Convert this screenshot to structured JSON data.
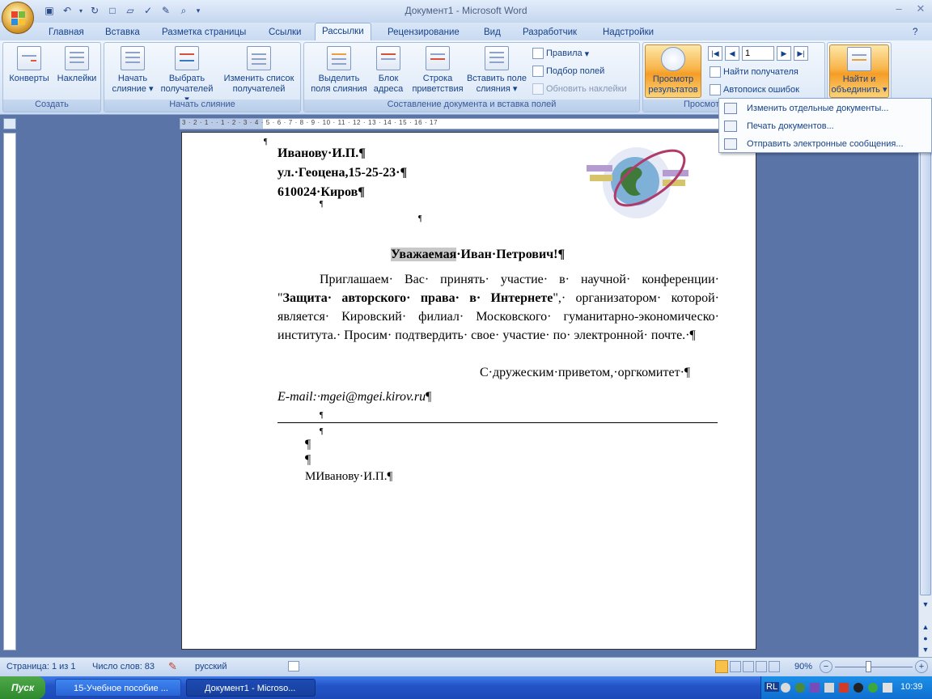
{
  "window": {
    "title": "Документ1 - Microsoft Word"
  },
  "tabs": [
    "Главная",
    "Вставка",
    "Разметка страницы",
    "Ссылки",
    "Рассылки",
    "Рецензирование",
    "Вид",
    "Разработчик",
    "Надстройки"
  ],
  "ribbon": {
    "groups": [
      "Создать",
      "Начать слияние",
      "Составление документа и вставка полей",
      "Просмотр результатов"
    ],
    "create": {
      "envelopes": "Конверты",
      "labels": "Наклейки"
    },
    "start": {
      "start_merge_1": "Начать",
      "start_merge_2": "слияние",
      "select_1": "Выбрать",
      "select_2": "получателей",
      "edit_1": "Изменить список",
      "edit_2": "получателей"
    },
    "compose": {
      "highlight_1": "Выделить",
      "highlight_2": "поля слияния",
      "address_1": "Блок",
      "address_2": "адреса",
      "greeting_1": "Строка",
      "greeting_2": "приветствия",
      "insert_1": "Вставить поле",
      "insert_2": "слияния",
      "rules": "Правила",
      "match": "Подбор полей",
      "update": "Обновить наклейки"
    },
    "preview": {
      "preview_1": "Просмотр",
      "preview_2": "результатов",
      "record": "1",
      "find": "Найти получателя",
      "auto": "Автопоиск ошибок"
    },
    "finish": {
      "finish_1": "Найти и",
      "finish_2": "объединить"
    }
  },
  "dropdown": [
    "Изменить отдельные документы...",
    "Печать документов...",
    "Отправить электронные сообщения..."
  ],
  "ruler": {
    "h": "3 · 2 · 1 · · 1 · 2 · 3 · 4 · 5 · 6 · 7 · 8 · 9 · 10 · 11 · 12 · 13 · 14 · 15 · 16 · 17"
  },
  "document": {
    "addr1": "Иванову·И.П.¶",
    "addr2": "ул.·Геоцена,15-25-23·¶",
    "addr3": "610024·Киров¶",
    "greeting_hl": "Уважаемая",
    "greeting_rest": "·Иван·Петрович!¶",
    "body_a": "Приглашаем· Вас· принять· участие· в· научной· конференции· \"",
    "body_bold": "Защита· авторского· права· в· Интернете",
    "body_b": "\",· организатором· которой· является· Кировский· филиал· Московского· гуманитарно-экономическо· института.· Просим· подтвердить· свое· участие· по· электронной· почте.·¶",
    "closing": "С·дружеским·приветом,·оргкомитет·¶",
    "email": "E-mail:·mgei@mgei.kirov.ru",
    "email_end": "¶",
    "pil": "¶",
    "sign": "МИванову·И.П.¶"
  },
  "status": {
    "page": "Страница: 1 из 1",
    "words": "Число слов: 83",
    "lang": "русский",
    "zoom": "90%"
  },
  "taskbar": {
    "start": "Пуск",
    "task1": "15-Учебное пособие ...",
    "task2": "Документ1 - Microso...",
    "lang": "RL",
    "time": "10:39"
  }
}
